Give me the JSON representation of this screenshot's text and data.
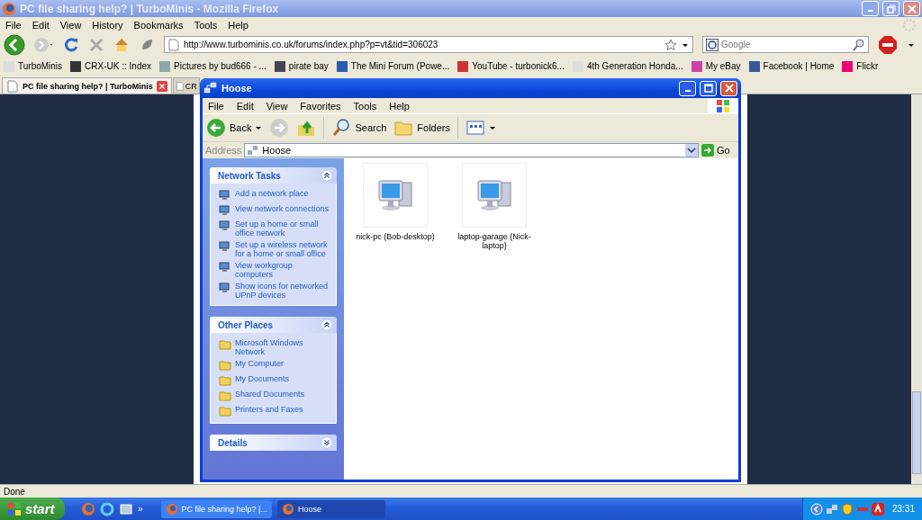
{
  "browser": {
    "title": "PC file sharing help? | TurboMinis - Mozilla Firefox",
    "menu": [
      "File",
      "Edit",
      "View",
      "History",
      "Bookmarks",
      "Tools",
      "Help"
    ],
    "url": "http://www.turbominis.co.uk/forums/index.php?p=vt&tid=306023",
    "search_placeholder": "Google",
    "bookmarks": [
      "TurboMinis",
      "CRX-UK :: Index",
      "Pictures by bud666 - ...",
      "pirate bay",
      "The Mini Forum (Powe...",
      "YouTube - turbonick6...",
      "4th Generation Honda...",
      "My eBay",
      "Facebook | Home",
      "Flickr"
    ],
    "tabs": [
      {
        "label": "PC file sharing help? | TurboMinis",
        "selected": true
      },
      {
        "label": "CR",
        "selected": false
      }
    ],
    "status": "Done"
  },
  "explorer": {
    "title": "Hoose",
    "menu": [
      "File",
      "Edit",
      "View",
      "Favorites",
      "Tools",
      "Help"
    ],
    "back": "Back",
    "search": "Search",
    "folders": "Folders",
    "address_label": "Address",
    "address": "Hoose",
    "go": "Go",
    "panels": [
      {
        "title": "Network Tasks",
        "expanded": true,
        "items": [
          "Add a network place",
          "View network connections",
          "Set up a home or small office network",
          "Set up a wireless network for a home or small office",
          "View workgroup computers",
          "Show icons for networked UPnP devices"
        ]
      },
      {
        "title": "Other Places",
        "expanded": true,
        "items": [
          "Microsoft Windows Network",
          "My Computer",
          "My Documents",
          "Shared Documents",
          "Printers and Faxes"
        ]
      },
      {
        "title": "Details",
        "expanded": false
      }
    ],
    "computers": [
      "nick-pc (Bob-desktop)",
      "laptop-garage (Nick-laptop)"
    ]
  },
  "taskbar": {
    "start": "start",
    "more": "»",
    "tasks": [
      {
        "label": "PC file sharing help? |...",
        "selected": false
      },
      {
        "label": "Hoose",
        "selected": true
      }
    ],
    "clock": "23:31"
  }
}
